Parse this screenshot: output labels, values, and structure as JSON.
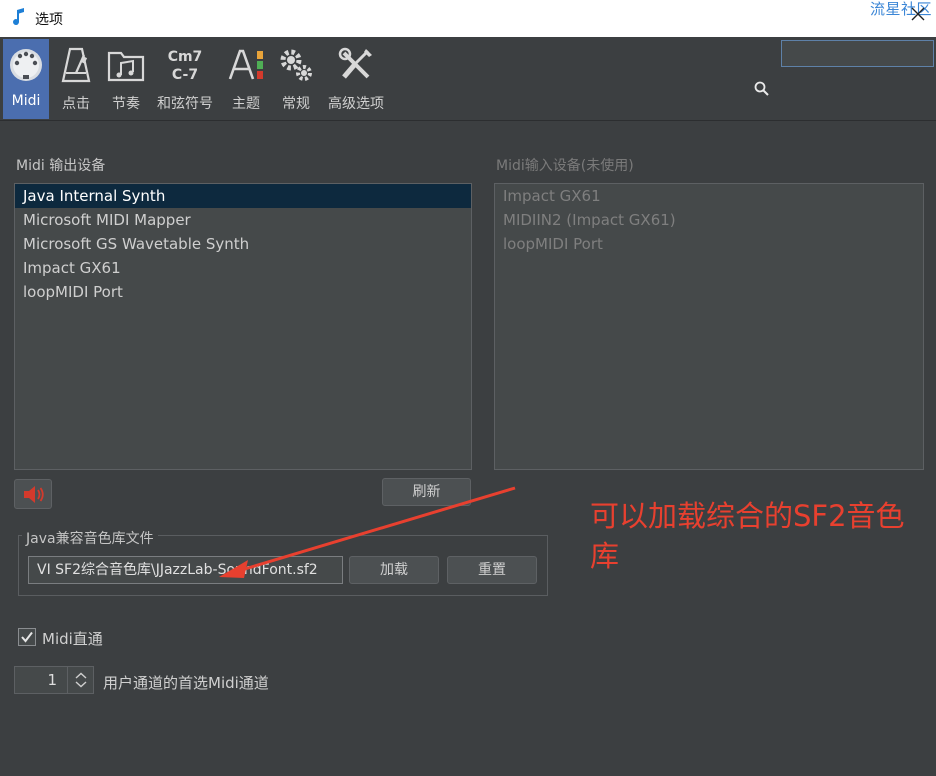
{
  "window": {
    "title": "选项",
    "watermark": "流星社区"
  },
  "toolbar": {
    "items": [
      {
        "label": "Midi",
        "icon": "midi-connector-icon",
        "active": true
      },
      {
        "label": "点击",
        "icon": "metronome-icon",
        "active": false
      },
      {
        "label": "节奏",
        "icon": "music-folder-icon",
        "active": false
      },
      {
        "label": "和弦符号",
        "icon": "chord-symbol-icon",
        "icon_text_top": "Cm7",
        "icon_text_bottom": "C-7",
        "active": false
      },
      {
        "label": "主题",
        "icon": "theme-font-color-icon",
        "active": false
      },
      {
        "label": "常规",
        "icon": "gears-icon",
        "active": false
      },
      {
        "label": "高级选项",
        "icon": "tools-icon",
        "active": false
      }
    ],
    "search": {
      "value": "",
      "placeholder": ""
    }
  },
  "midi_out": {
    "label": "Midi 输出设备",
    "devices": [
      "Java Internal Synth",
      "Microsoft MIDI Mapper",
      "Microsoft GS Wavetable Synth",
      "Impact GX61",
      "loopMIDI Port"
    ],
    "selected_index": 0
  },
  "midi_in": {
    "label": "Midi输入设备(未使用)",
    "devices": [
      "Impact GX61",
      "MIDIIN2 (Impact GX61)",
      "loopMIDI Port"
    ]
  },
  "buttons": {
    "refresh": "刷新",
    "load": "加载",
    "reset": "重置"
  },
  "soundfont": {
    "group_label": "Java兼容音色库文件",
    "file_value": "VI SF2综合音色库\\JJazzLab-SoundFont.sf2"
  },
  "annotation": {
    "text": "可以加载综合的SF2音色库",
    "color": "#e8402f"
  },
  "midi_thru": {
    "label": "Midi直通",
    "checked": true
  },
  "channel": {
    "value": "1",
    "label": "用户通道的首选Midi通道"
  },
  "colors": {
    "background": "#3c3f41",
    "active_tab": "#4b6eaf",
    "selected_row": "#0d293e",
    "speaker_icon": "#d33a2c"
  }
}
